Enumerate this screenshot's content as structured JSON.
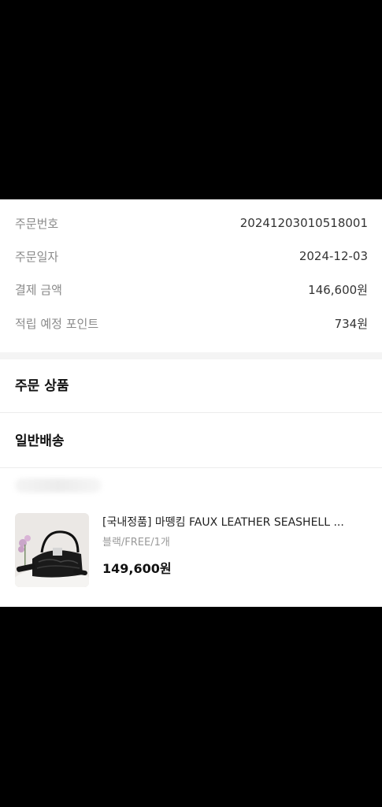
{
  "order_info": {
    "rows": [
      {
        "label": "주문번호",
        "value": "20241203010518001"
      },
      {
        "label": "주문일자",
        "value": "2024-12-03"
      },
      {
        "label": "결제 금액",
        "value": "146,600원"
      },
      {
        "label": "적립 예정 포인트",
        "value": "734원"
      }
    ]
  },
  "sections": {
    "ordered_products_title": "주문 상품",
    "shipping_type_title": "일반배송"
  },
  "product": {
    "image_icon": "bag-thumbnail",
    "name": "[국내정품] 마뗑킴 FAUX LEATHER SEASHELL ...",
    "option": "블랙/FREE/1개",
    "price": "149,600원"
  },
  "colors": {
    "background": "#000000",
    "sheet": "#ffffff",
    "label": "#8a8a8a",
    "divider": "#ececec"
  }
}
